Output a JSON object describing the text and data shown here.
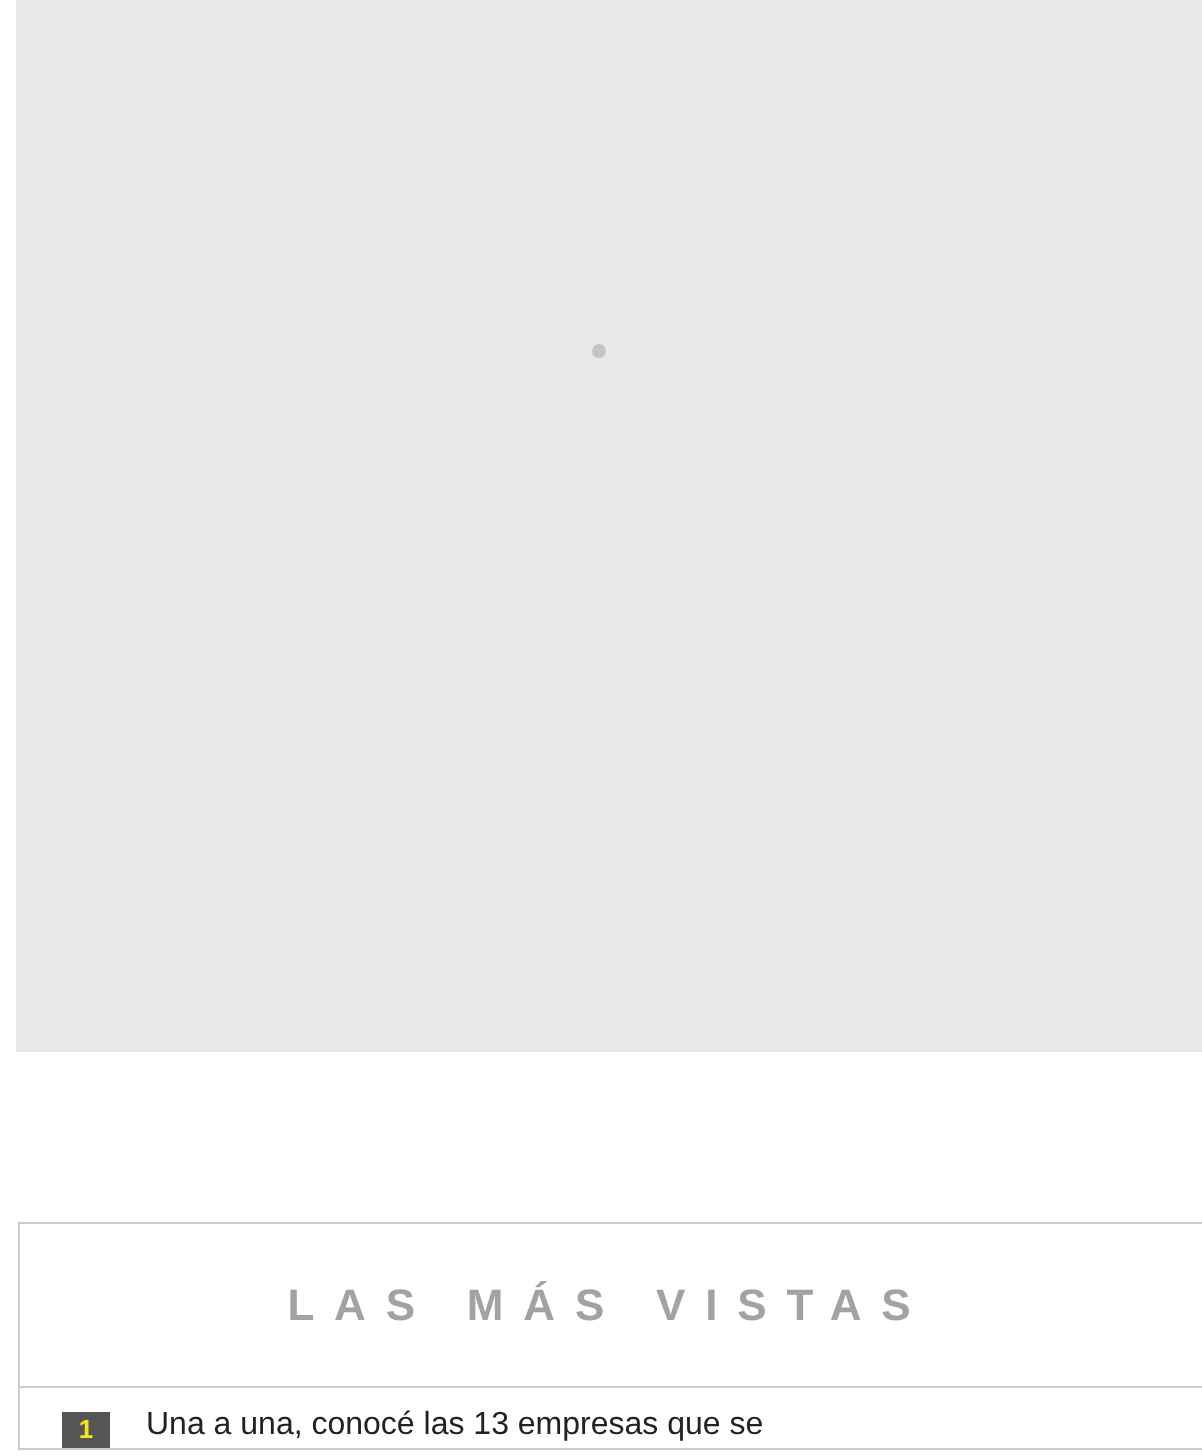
{
  "ad_placeholder": {
    "loading": true
  },
  "most_viewed": {
    "title": "LAS MÁS VISTAS",
    "items": [
      {
        "rank": "1",
        "title": "Una a una, conocé las 13 empresas que se"
      }
    ]
  }
}
